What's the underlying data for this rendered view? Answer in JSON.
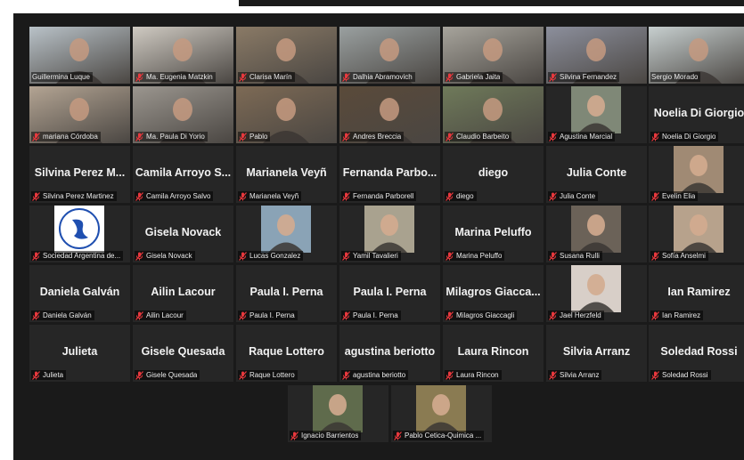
{
  "participants": [
    {
      "name": "Guillermina Luque",
      "display": "",
      "muted": false,
      "video": true,
      "speaking": false,
      "bg": "#b9c2c8"
    },
    {
      "name": "Ma. Eugenia Matzkin",
      "display": "",
      "muted": true,
      "video": true,
      "speaking": false,
      "bg": "#cfcac2"
    },
    {
      "name": "Clarisa Marín",
      "display": "",
      "muted": true,
      "video": true,
      "speaking": false,
      "bg": "#8a7a66"
    },
    {
      "name": "Dalhia Abramovich",
      "display": "",
      "muted": true,
      "video": true,
      "speaking": false,
      "bg": "#9aa0a0"
    },
    {
      "name": "Gabriela Jaita",
      "display": "",
      "muted": true,
      "video": true,
      "speaking": false,
      "bg": "#a7a49c"
    },
    {
      "name": "Silvina Fernandez",
      "display": "",
      "muted": true,
      "video": true,
      "speaking": false,
      "bg": "#8c8f9c"
    },
    {
      "name": "Sergio Morado",
      "display": "",
      "muted": false,
      "video": true,
      "speaking": true,
      "bg": "#c7cfcf"
    },
    {
      "name": "mariana Córdoba",
      "display": "",
      "muted": true,
      "video": true,
      "speaking": false,
      "bg": "#b3a493"
    },
    {
      "name": "Ma. Paula Di Yorio",
      "display": "",
      "muted": true,
      "video": true,
      "speaking": false,
      "bg": "#9b968f"
    },
    {
      "name": "Pablo",
      "display": "",
      "muted": true,
      "video": true,
      "speaking": false,
      "bg": "#7d6a55"
    },
    {
      "name": "Andres Breccia",
      "display": "",
      "muted": true,
      "video": true,
      "speaking": false,
      "bg": "#5a4a3a"
    },
    {
      "name": "Claudio Barbeito",
      "display": "",
      "muted": true,
      "video": true,
      "speaking": false,
      "bg": "#6f7a5a"
    },
    {
      "name": "Agustina Marcial",
      "display": "",
      "muted": true,
      "video": false,
      "photo": true,
      "speaking": false,
      "bg": "#7f8877"
    },
    {
      "name": "Noelia Di Giorgio",
      "display": "Noelia Di Giorgio",
      "muted": true,
      "video": false,
      "speaking": false
    },
    {
      "name": "Silvina Perez Martinez",
      "display": "Silvina Perez M...",
      "muted": true,
      "video": false,
      "speaking": false
    },
    {
      "name": "Camila Arroyo Salvo",
      "display": "Camila Arroyo S...",
      "muted": true,
      "video": false,
      "speaking": false
    },
    {
      "name": "Marianela Veyñ",
      "display": "Marianela Veyñ",
      "muted": true,
      "video": false,
      "speaking": false
    },
    {
      "name": "Fernanda Parborell",
      "display": "Fernanda Parbo...",
      "muted": true,
      "video": false,
      "speaking": false
    },
    {
      "name": "diego",
      "display": "diego",
      "muted": true,
      "video": false,
      "speaking": false
    },
    {
      "name": "Julia Conte",
      "display": "Julia Conte",
      "muted": true,
      "video": false,
      "speaking": false
    },
    {
      "name": "Evelin Elia",
      "display": "",
      "muted": true,
      "video": false,
      "photo": true,
      "speaking": false,
      "bg": "#a08a74"
    },
    {
      "name": "Sociedad Argentina de...",
      "display": "",
      "muted": true,
      "video": false,
      "photo": true,
      "logo": true,
      "speaking": false,
      "bg": "#ffffff"
    },
    {
      "name": "Gisela Novack",
      "display": "Gisela Novack",
      "muted": true,
      "video": false,
      "speaking": false
    },
    {
      "name": "Lucas Gonzalez",
      "display": "",
      "muted": true,
      "video": false,
      "photo": true,
      "speaking": false,
      "bg": "#8aa3b6"
    },
    {
      "name": "Yamil Tavalieri",
      "display": "",
      "muted": true,
      "video": false,
      "photo": true,
      "speaking": false,
      "bg": "#a9a28f"
    },
    {
      "name": "Marina Peluffo",
      "display": "Marina Peluffo",
      "muted": true,
      "video": false,
      "speaking": false
    },
    {
      "name": "Susana Rulli",
      "display": "",
      "muted": true,
      "video": false,
      "photo": true,
      "speaking": false,
      "bg": "#6b6258"
    },
    {
      "name": "Sofía Anselmi",
      "display": "",
      "muted": true,
      "video": false,
      "photo": true,
      "speaking": false,
      "bg": "#b7a28c"
    },
    {
      "name": "Daniela Galván",
      "display": "Daniela Galván",
      "muted": true,
      "video": false,
      "speaking": false
    },
    {
      "name": "Ailin Lacour",
      "display": "Ailin Lacour",
      "muted": true,
      "video": false,
      "speaking": false
    },
    {
      "name": "Paula I. Perna",
      "display": "Paula I. Perna",
      "muted": true,
      "video": false,
      "speaking": false
    },
    {
      "name": "Paula I. Perna",
      "display": "Paula I. Perna",
      "muted": true,
      "video": false,
      "speaking": false
    },
    {
      "name": "Milagros Giaccagli",
      "display": "Milagros Giacca...",
      "muted": true,
      "video": false,
      "speaking": false
    },
    {
      "name": "Jael Herzfeld",
      "display": "",
      "muted": true,
      "video": false,
      "photo": true,
      "speaking": false,
      "bg": "#d8cfc8"
    },
    {
      "name": "Ian Ramirez",
      "display": "Ian Ramirez",
      "muted": true,
      "video": false,
      "speaking": false
    },
    {
      "name": "Julieta",
      "display": "Julieta",
      "muted": true,
      "video": false,
      "speaking": false
    },
    {
      "name": "Gisele Quesada",
      "display": "Gisele Quesada",
      "muted": true,
      "video": false,
      "speaking": false
    },
    {
      "name": "Raque Lottero",
      "display": "Raque Lottero",
      "muted": true,
      "video": false,
      "speaking": false
    },
    {
      "name": "agustina beriotto",
      "display": "agustina beriotto",
      "muted": true,
      "video": false,
      "speaking": false
    },
    {
      "name": "Laura Rincon",
      "display": "Laura Rincon",
      "muted": true,
      "video": false,
      "speaking": false
    },
    {
      "name": "Silvia Arranz",
      "display": "Silvia Arranz",
      "muted": true,
      "video": false,
      "speaking": false
    },
    {
      "name": "Soledad Rossi",
      "display": "Soledad Rossi",
      "muted": true,
      "video": false,
      "speaking": false
    },
    {
      "name": "Ignacio Barrientos",
      "display": "",
      "muted": true,
      "video": false,
      "photo": true,
      "speaking": false,
      "bg": "#5f6b4c"
    },
    {
      "name": "Pablo Cetica-Quimica ...",
      "display": "",
      "muted": true,
      "video": false,
      "photo": true,
      "speaking": false,
      "bg": "#8a7b52"
    }
  ],
  "colors": {
    "muted_icon": "#e8383d",
    "speaking_border": "#c9d41f",
    "tile_bg": "#262626",
    "window_bg": "#1a1a1a"
  }
}
